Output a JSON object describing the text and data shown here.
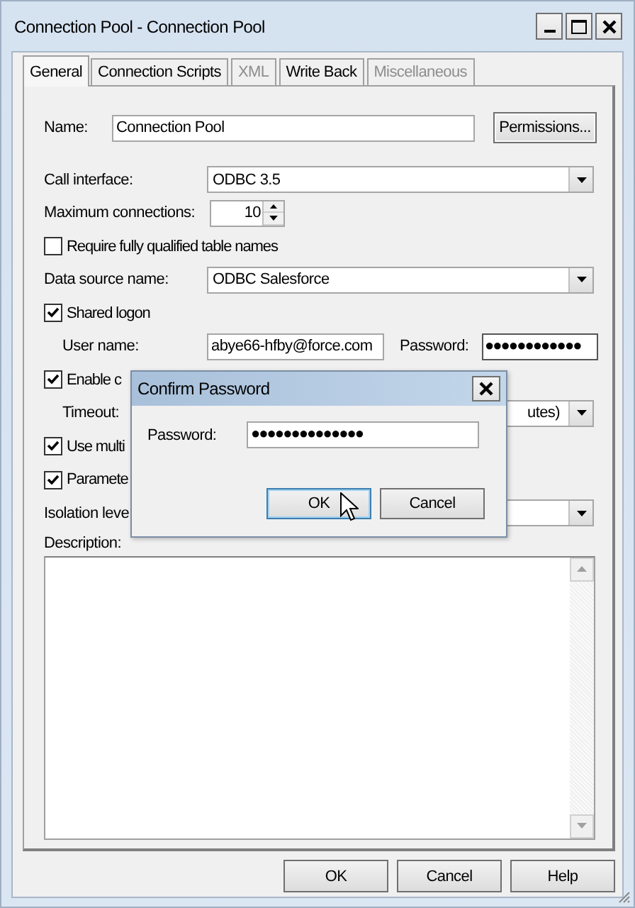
{
  "window": {
    "title": "Connection Pool - Connection Pool"
  },
  "tabs": [
    {
      "label": "General",
      "selected": true,
      "disabled": false
    },
    {
      "label": "Connection Scripts",
      "selected": false,
      "disabled": false
    },
    {
      "label": "XML",
      "selected": false,
      "disabled": true
    },
    {
      "label": "Write Back",
      "selected": false,
      "disabled": false
    },
    {
      "label": "Miscellaneous",
      "selected": false,
      "disabled": true
    }
  ],
  "form": [
    {
      "kind": "name",
      "label": "Name:",
      "value": "Connection Pool",
      "button": "Permissions..."
    },
    {
      "kind": "dropdown",
      "label": "Call interface:",
      "value": "ODBC 3.5",
      "indent": false
    },
    {
      "kind": "spinner",
      "label": "Maximum connections:",
      "value": "10"
    },
    {
      "kind": "checkbox",
      "label": "Require fully qualified table names",
      "checked": false
    },
    {
      "kind": "dropdown",
      "label": "Data source name:",
      "value": "ODBC Salesforce",
      "indent": false
    },
    {
      "kind": "checkbox",
      "label": "Shared logon",
      "checked": true
    },
    {
      "kind": "credentials",
      "label": "User name:",
      "value": "abye66-hfby@force.com",
      "password_label": "Password:",
      "password": "●●●●●●●●●●●●"
    },
    {
      "kind": "checkbox",
      "label": "Enable c",
      "checked": true
    },
    {
      "kind": "dropdown",
      "label": "Timeout:",
      "value": "utes)",
      "indent": true
    },
    {
      "kind": "checkbox",
      "label": "Use multi",
      "checked": true
    },
    {
      "kind": "checkbox",
      "label": "Paramete",
      "checked": true
    },
    {
      "kind": "dropdown",
      "label": "Isolation leve",
      "indent": false
    },
    {
      "kind": "label",
      "label": "Description:"
    },
    {
      "kind": "textarea"
    }
  ],
  "buttons": [
    "OK",
    "Cancel",
    "Help"
  ],
  "dialog": {
    "title": "Confirm Password",
    "label": "Password:",
    "value": "●●●●●●●●●●●●●●",
    "buttons": [
      {
        "label": "OK",
        "focused": true
      },
      {
        "label": "Cancel",
        "focused": false
      }
    ]
  }
}
